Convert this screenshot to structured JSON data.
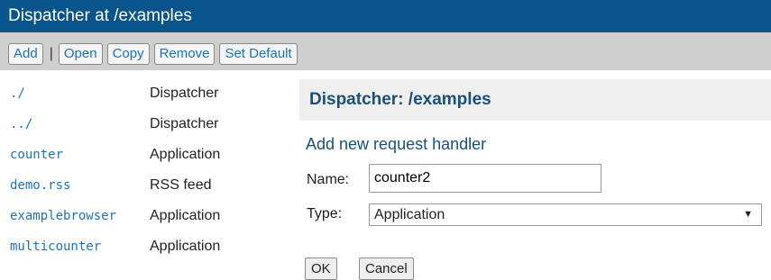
{
  "title": "Dispatcher at /examples",
  "toolbar": {
    "add": "Add",
    "separator": "|",
    "open": "Open",
    "copy": "Copy",
    "remove": "Remove",
    "set_default": "Set Default"
  },
  "handlers": [
    {
      "name": "./",
      "type": "Dispatcher"
    },
    {
      "name": "../",
      "type": "Dispatcher"
    },
    {
      "name": "counter",
      "type": "Application"
    },
    {
      "name": "demo.rss",
      "type": "RSS feed"
    },
    {
      "name": "examplebrowser",
      "type": "Application"
    },
    {
      "name": "multicounter",
      "type": "Application"
    }
  ],
  "panel": {
    "heading": "Dispatcher: /examples",
    "subheading": "Add new request handler",
    "name_label": "Name:",
    "name_value": "counter2",
    "type_label": "Type:",
    "type_value": "Application",
    "ok": "OK",
    "cancel": "Cancel"
  }
}
